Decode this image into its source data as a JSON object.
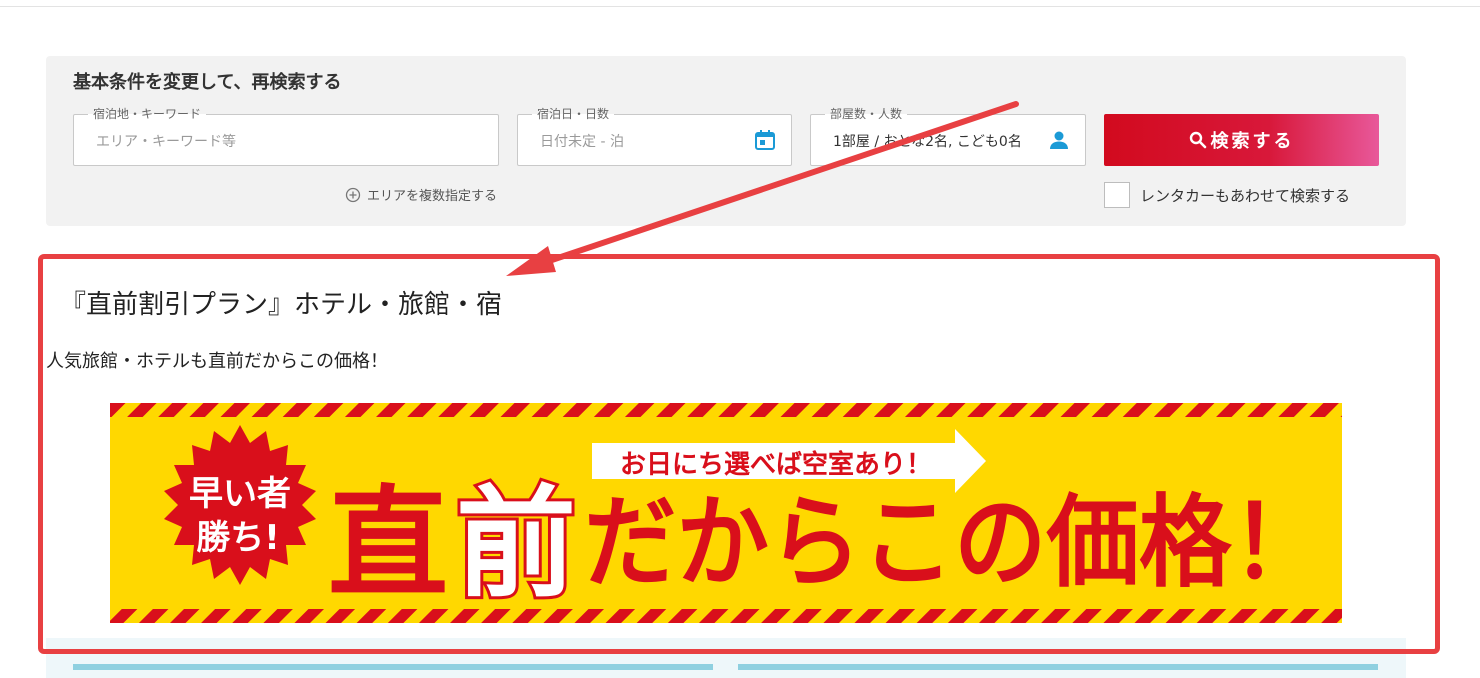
{
  "search": {
    "heading": "基本条件を変更して、再検索する",
    "keyword": {
      "label": "宿泊地・キーワード",
      "placeholder": "エリア・キーワード等"
    },
    "dates": {
      "label": "宿泊日・日数",
      "value": "日付未定 - 泊"
    },
    "rooms": {
      "label": "部屋数・人数",
      "value": "1部屋 / おとな2名, こども0名"
    },
    "multi_area_link": "エリアを複数指定する",
    "search_button": "検索する",
    "rental_car_label": "レンタカーもあわせて検索する",
    "accent_color": "#d20a1e"
  },
  "plan": {
    "title": "『直前割引プラン』ホテル・旅館・宿",
    "subtitle": "人気旅館・ホテルも直前だからこの価格！"
  },
  "banner": {
    "badge_line1": "早い者",
    "badge_line2": "勝ち!",
    "callout": "お日にち選べば空室あり！",
    "main_text_a": "直",
    "main_text_b": "前",
    "main_text_c": "だからこの価格！",
    "bg_color": "#ffd800",
    "text_color": "#d90f1b"
  },
  "annotation": {
    "highlight_color": "#e84042"
  }
}
